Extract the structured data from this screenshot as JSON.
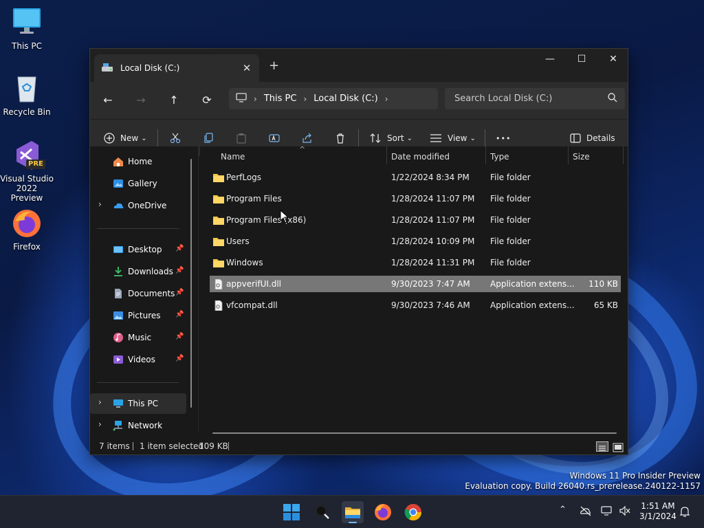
{
  "desktop": {
    "icons": [
      {
        "label": "This PC"
      },
      {
        "label": "Recycle Bin"
      },
      {
        "label": "Visual Studio 2022 Preview",
        "badge": "PRE"
      },
      {
        "label": "Firefox"
      }
    ],
    "watermark": {
      "line1": "Windows 11 Pro Insider Preview",
      "line2": "Evaluation copy. Build 26040.rs_prerelease.240122-1157"
    }
  },
  "window": {
    "tab_title": "Local Disk (C:)",
    "new_tab": "+",
    "tab_close": "✕",
    "controls": {
      "minimize": "—",
      "maximize": "☐",
      "close": "✕"
    }
  },
  "address": {
    "back": "←",
    "forward": "→",
    "up": "↑",
    "refresh": "⟳",
    "crumbs": [
      "This PC",
      "Local Disk (C:)"
    ],
    "sep": "›",
    "search_placeholder": "Search Local Disk (C:)"
  },
  "toolbar": {
    "new_label": "New",
    "sort_label": "Sort",
    "view_label": "View",
    "more": "•••",
    "details_label": "Details",
    "caret": "⌄"
  },
  "nav": {
    "items": [
      {
        "label": "Home",
        "icon": "home-icon"
      },
      {
        "label": "Gallery",
        "icon": "gallery-icon"
      },
      {
        "label": "OneDrive",
        "icon": "onedrive-icon",
        "expander": "›"
      }
    ],
    "quick": [
      {
        "label": "Desktop",
        "icon": "desktop-icon"
      },
      {
        "label": "Downloads",
        "icon": "downloads-icon"
      },
      {
        "label": "Documents",
        "icon": "documents-icon"
      },
      {
        "label": "Pictures",
        "icon": "pictures-icon"
      },
      {
        "label": "Music",
        "icon": "music-icon"
      },
      {
        "label": "Videos",
        "icon": "videos-icon"
      }
    ],
    "pin": "📌",
    "bottom": [
      {
        "label": "This PC",
        "icon": "this-pc-icon",
        "expander": "›",
        "selected": true
      },
      {
        "label": "Network",
        "icon": "network-icon",
        "expander": "›"
      }
    ]
  },
  "files": {
    "columns": [
      "Name",
      "Date modified",
      "Type",
      "Size"
    ],
    "sort_indicator": "^",
    "rows": [
      {
        "name": "PerfLogs",
        "date": "1/22/2024 8:34 PM",
        "type": "File folder",
        "size": "",
        "kind": "folder"
      },
      {
        "name": "Program Files",
        "date": "1/28/2024 11:07 PM",
        "type": "File folder",
        "size": "",
        "kind": "folder"
      },
      {
        "name": "Program Files (x86)",
        "date": "1/28/2024 11:07 PM",
        "type": "File folder",
        "size": "",
        "kind": "folder"
      },
      {
        "name": "Users",
        "date": "1/28/2024 10:09 PM",
        "type": "File folder",
        "size": "",
        "kind": "folder"
      },
      {
        "name": "Windows",
        "date": "1/28/2024 11:31 PM",
        "type": "File folder",
        "size": "",
        "kind": "folder"
      },
      {
        "name": "appverifUI.dll",
        "date": "9/30/2023 7:47 AM",
        "type": "Application extens...",
        "size": "110 KB",
        "kind": "dll",
        "selected": true
      },
      {
        "name": "vfcompat.dll",
        "date": "9/30/2023 7:46 AM",
        "type": "Application extens...",
        "size": "65 KB",
        "kind": "dll"
      }
    ]
  },
  "status": {
    "items": "7 items",
    "selection": "1 item selected",
    "size": "109 KB"
  },
  "taskbar": {
    "time": "1:51 AM",
    "date": "3/1/2024",
    "chevron": "⌃"
  },
  "colors": {
    "folder": "#f4c94a",
    "accent": "#0078d4",
    "selection": "#777777"
  }
}
